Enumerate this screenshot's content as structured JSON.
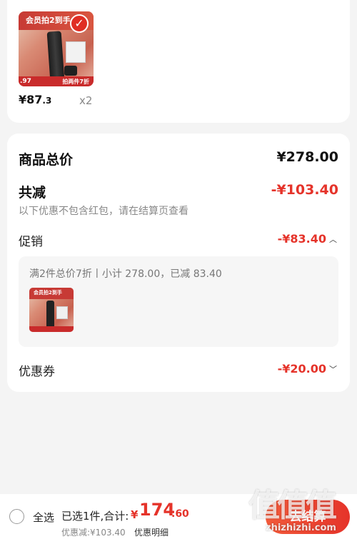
{
  "product": {
    "banner_text": "会员拍2到手",
    "footer_text": "拍两件7折",
    "discount_badge": ".97",
    "price_main": "¥87",
    "price_dec": ".3",
    "quantity": "x2"
  },
  "summary": {
    "goods_total_label": "商品总价",
    "goods_total_value": "¥278.00",
    "reduction_label": "共减",
    "reduction_value": "-¥103.40",
    "note": "以下优惠不包含红包，请在结算页查看",
    "promotion_label": "促销",
    "promotion_value": "-¥83.40",
    "promo_detail": "满2件总价7折丨小计 278.00，已减 83.40",
    "coupon_label": "优惠券",
    "coupon_value": "-¥20.00"
  },
  "bottom_bar": {
    "select_all": "全选",
    "selected_info": "已选1件,合计:",
    "total_symbol": "¥",
    "total_int": "174",
    "total_dec": ".60",
    "discount_line": "优惠减:¥103.40",
    "detail_link": "优惠明细",
    "checkout": "去结算"
  },
  "watermark": {
    "mark": "值值值",
    "url": "zhizhizhi.com"
  },
  "colors": {
    "accent": "#e5332a",
    "background": "#f4f4f4"
  }
}
